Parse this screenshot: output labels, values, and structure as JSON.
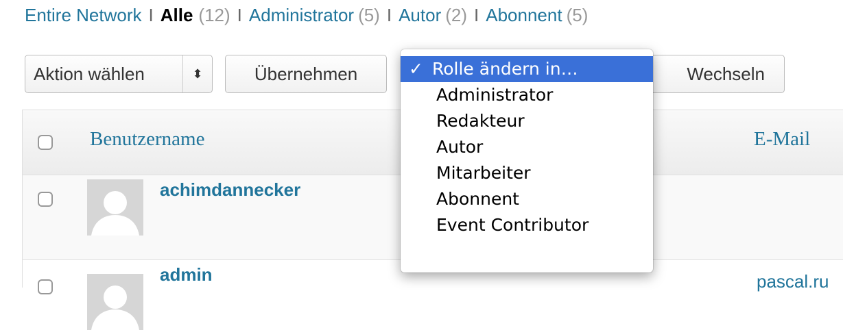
{
  "filters": {
    "entire_network": "Entire Network",
    "sep": "I",
    "items": [
      {
        "label": "Alle",
        "count": "(12)"
      },
      {
        "label": "Administrator",
        "count": "(5)"
      },
      {
        "label": "Autor",
        "count": "(2)"
      },
      {
        "label": "Abonnent",
        "count": "(5)"
      }
    ]
  },
  "bulk": {
    "select_label": "Aktion wählen",
    "arrows": "⬍",
    "apply_label": "Übernehmen"
  },
  "role_change": {
    "switch_label": "Wechseln",
    "check": "✓",
    "options": [
      "Rolle ändern in…",
      "Administrator",
      "Redakteur",
      "Autor",
      "Mitarbeiter",
      "Abonnent",
      "Event Contributor"
    ]
  },
  "table": {
    "col_username": "Benutzername",
    "col_email": "E-Mail",
    "rows": [
      {
        "username": "achimdannecker",
        "email": ""
      },
      {
        "username": "admin",
        "email": "pascal.ru"
      }
    ]
  },
  "colors": {
    "link": "#21759b",
    "highlight": "#3a70d8"
  }
}
